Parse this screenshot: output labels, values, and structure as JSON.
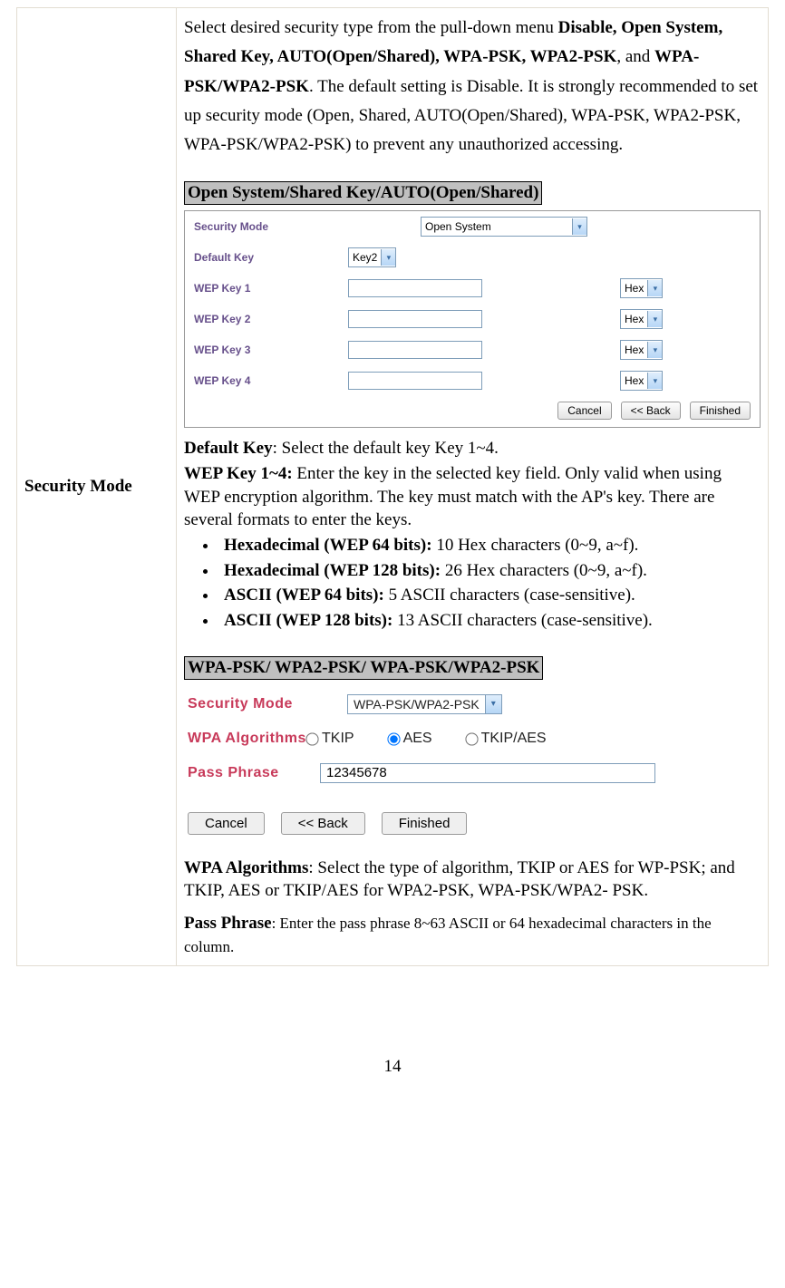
{
  "row_label": "Security Mode",
  "intro": {
    "pre": "Select desired security type from the pull-down menu ",
    "bold1": "Disable, Open System, Shared Key, AUTO(Open/Shared), WPA-PSK, WPA2-PSK",
    "mid": ", and ",
    "bold2": "WPA-PSK/WPA2-PSK",
    "post": ". The default setting is Disable. It is strongly recommended to set up security mode (Open, Shared, AUTO(Open/Shared), WPA-PSK, WPA2-PSK, WPA-PSK/WPA2-PSK) to prevent any unauthorized accessing."
  },
  "sec1": {
    "header": "Open System/Shared Key/AUTO(Open/Shared)",
    "labels": {
      "security_mode": "Security Mode",
      "default_key": "Default Key",
      "wep1": "WEP Key 1",
      "wep2": "WEP Key 2",
      "wep3": "WEP Key 3",
      "wep4": "WEP Key 4"
    },
    "security_mode_value": "Open System",
    "default_key_value": "Key2",
    "hex_label": "Hex",
    "buttons": {
      "cancel": "Cancel",
      "back": "<<  Back",
      "finished": "Finished"
    },
    "desc": {
      "defkey_b": "Default Key",
      "defkey_t": ": Select the default key Key 1~4.",
      "wepkeys_b": "WEP Key 1~4:",
      "wepkeys_t": " Enter the key in the selected key field. Only valid when using WEP encryption algorithm. The key must match with the AP's key. There are several formats to enter the keys.",
      "bullets": [
        {
          "b": "Hexadecimal (WEP 64 bits):",
          "t": " 10 Hex characters (0~9, a~f)."
        },
        {
          "b": "Hexadecimal (WEP 128 bits):",
          "t": " 26 Hex characters (0~9, a~f)."
        },
        {
          "b": "ASCII (WEP 64 bits):",
          "t": " 5 ASCII characters (case-sensitive)."
        },
        {
          "b": "ASCII (WEP 128 bits):",
          "t": " 13 ASCII characters (case-sensitive)."
        }
      ]
    }
  },
  "sec2": {
    "header": "WPA-PSK/ WPA2-PSK/ WPA-PSK/WPA2-PSK",
    "labels": {
      "security_mode": "Security Mode",
      "wpa_algorithms": "WPA Algorithms",
      "pass_phrase": "Pass Phrase"
    },
    "security_mode_value": "WPA-PSK/WPA2-PSK",
    "radios": {
      "tkip": "TKIP",
      "aes": "AES",
      "tkipaes": "TKIP/AES"
    },
    "pass_phrase_value": "12345678",
    "buttons": {
      "cancel": "Cancel",
      "back": "<<  Back",
      "finished": "Finished"
    },
    "desc": {
      "wpaalg_b": "WPA Algorithms",
      "wpaalg_t": ": Select the type of algorithm, TKIP or AES for WP-PSK; and TKIP, AES or TKIP/AES for WPA2-PSK, WPA-PSK/WPA2- PSK.",
      "pass_b": "Pass Phrase",
      "pass_t": ": Enter the pass phrase 8~63 ASCII or 64 hexadecimal characters in the column."
    }
  },
  "page_number": "14"
}
